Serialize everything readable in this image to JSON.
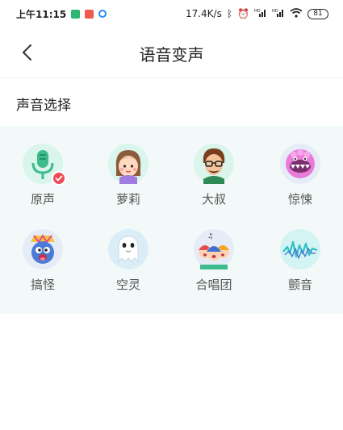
{
  "status_bar": {
    "time": "上午11:15",
    "speed": "17.4K/s",
    "icons": [
      "bluetooth-icon",
      "alarm-icon",
      "signal-hd-icon",
      "signal-hd-icon",
      "wifi-icon"
    ],
    "battery": "81"
  },
  "nav": {
    "title": "语音变声",
    "back_icon": "back-arrow-icon"
  },
  "section": {
    "title": "声音选择"
  },
  "voices": [
    {
      "label": "原声",
      "icon": "microphone-icon",
      "selected": true,
      "bg": "#d9f5ec"
    },
    {
      "label": "萝莉",
      "icon": "girl-avatar-icon",
      "selected": false,
      "bg": "#d9f5ec"
    },
    {
      "label": "大叔",
      "icon": "uncle-avatar-icon",
      "selected": false,
      "bg": "#d9f5ec"
    },
    {
      "label": "惊悚",
      "icon": "monster-icon",
      "selected": false,
      "bg": "#e6ecf7"
    },
    {
      "label": "搞怪",
      "icon": "funny-face-icon",
      "selected": false,
      "bg": "#e6ecf7"
    },
    {
      "label": "空灵",
      "icon": "ghost-icon",
      "selected": false,
      "bg": "#dbeef7"
    },
    {
      "label": "合唱团",
      "icon": "choir-icon",
      "selected": false,
      "bg": "#e6ecf7"
    },
    {
      "label": "颤音",
      "icon": "vibrato-wave-icon",
      "selected": false,
      "bg": "#d4f3f3"
    }
  ],
  "colors": {
    "accent_green": "#3dbb8c",
    "selected_badge": "#f04a56",
    "panel_bg": "#f2f9f8"
  }
}
